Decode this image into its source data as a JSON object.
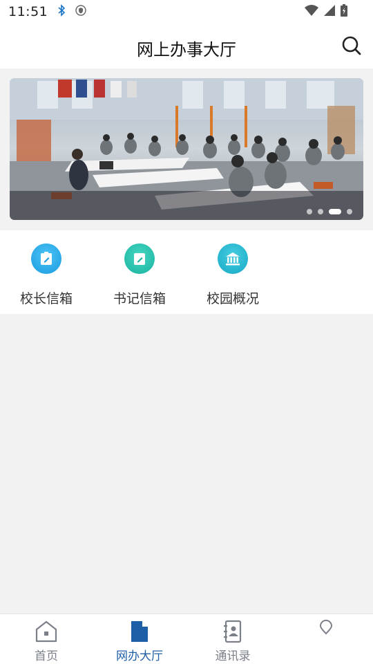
{
  "status_bar": {
    "time": "11:51"
  },
  "header": {
    "title": "网上办事大厅"
  },
  "banner": {
    "slides": 4,
    "active_slide": 3
  },
  "quick_actions": [
    {
      "label": "校长信箱",
      "icon": "mailbox-edit-icon",
      "color": "#1ea7e6"
    },
    {
      "label": "书记信箱",
      "icon": "mailbox-edit-icon",
      "color": "#1fbfae"
    },
    {
      "label": "校园概况",
      "icon": "building-icon",
      "color": "#1cb4d0"
    }
  ],
  "tabs": [
    {
      "label": "首页",
      "icon": "home-icon",
      "active": false
    },
    {
      "label": "网办大厅",
      "icon": "document-icon",
      "active": true
    },
    {
      "label": "通讯录",
      "icon": "contacts-icon",
      "active": false
    },
    {
      "label": "",
      "icon": "location-icon",
      "active": false
    }
  ],
  "colors": {
    "accent": "#1f5fa8",
    "inactive": "#7a7f88",
    "background": "#f2f2f2"
  }
}
